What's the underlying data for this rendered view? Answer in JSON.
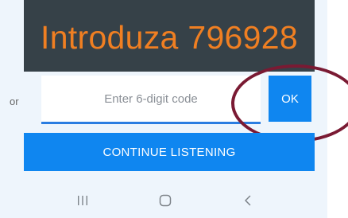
{
  "banner": {
    "text": "Introduza 796928",
    "text_color": "#f07f22",
    "background": "#364148"
  },
  "code_entry": {
    "or_label": "or",
    "input_value": "",
    "input_placeholder": "Enter 6-digit code",
    "ok_label": "OK"
  },
  "continue_label": "CONTINUE LISTENING",
  "nav_bar": {
    "recents_icon": "recents-icon",
    "home_icon": "home-icon",
    "back_icon": "back-icon"
  },
  "colors": {
    "accent": "#0f86f0",
    "input_underline": "#2a7de1",
    "highlight_circle": "#7a1a33",
    "page_background": "#eef5fc"
  }
}
